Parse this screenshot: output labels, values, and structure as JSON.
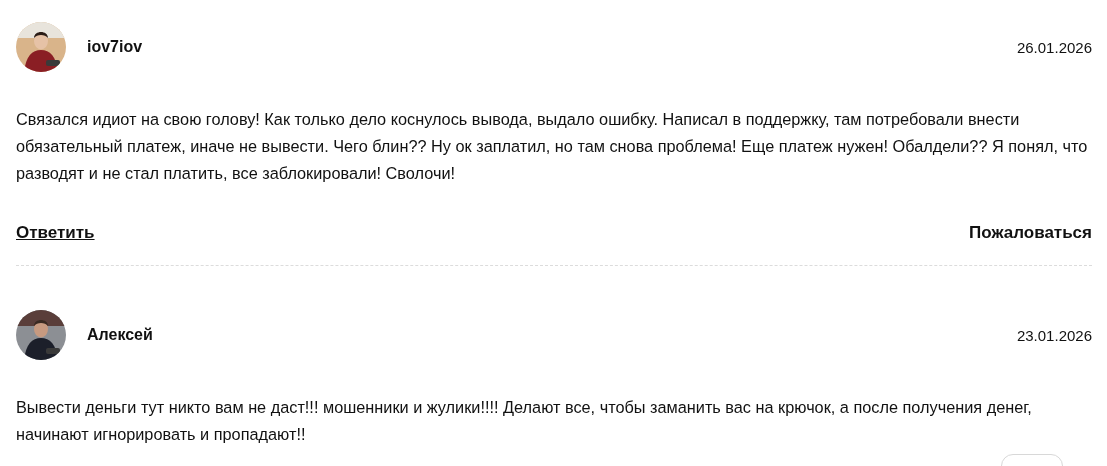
{
  "comments": [
    {
      "author": "iov7iov",
      "date": "26.01.2026",
      "text": "Связался идиот на свою голову! Как только дело коснулось вывода, выдало ошибку. Написал в поддержку, там потребовали внести обязательный платеж, иначе не вывести. Чего блин?? Ну ок заплатил, но там снова проблема! Еще платеж нужен! Обалдели?? Я понял, что разводят и не стал платить, все заблокировали! Сволочи!",
      "reply": "Ответить",
      "report": "Пожаловаться"
    },
    {
      "author": "Алексей",
      "date": "23.01.2026",
      "text": "Вывести деньги тут никто вам не даст!!! мошенники и жулики!!!! Делают все, чтобы заманить вас на крючок, а после получения денег, начинают игнорировать и пропадают!!"
    }
  ]
}
